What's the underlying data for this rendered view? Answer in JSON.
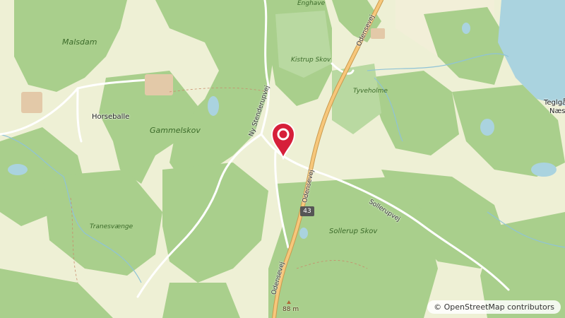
{
  "map": {
    "places": [
      {
        "name": "Enghave"
      },
      {
        "name": "Malsdam"
      },
      {
        "name": "Kistrup Skov"
      },
      {
        "name": "Tyveholme"
      },
      {
        "name": "Horseballe"
      },
      {
        "name": "Gammelskov"
      },
      {
        "name": "Tranesvænge"
      },
      {
        "name": "Sollerup Skov"
      },
      {
        "name": "Teglgå"
      },
      {
        "name": "Næs"
      }
    ],
    "roads": {
      "stenderupvej": "Ny Stenderupvej",
      "odensevej": "Odensevej",
      "sollerupvej": "Sollerupvej"
    },
    "route_shield": "43",
    "peak_elevation": "88 m",
    "marker": {
      "color": "#d61f3a",
      "icon": "map-pin-icon"
    },
    "colors": {
      "forest": "#a9cf8c",
      "field": "#eef0d5",
      "water": "#aad3df",
      "road": "#ffffff",
      "main_road": "#f7c77b"
    }
  },
  "attribution": {
    "symbol": "©",
    "text": "OpenStreetMap contributors"
  }
}
